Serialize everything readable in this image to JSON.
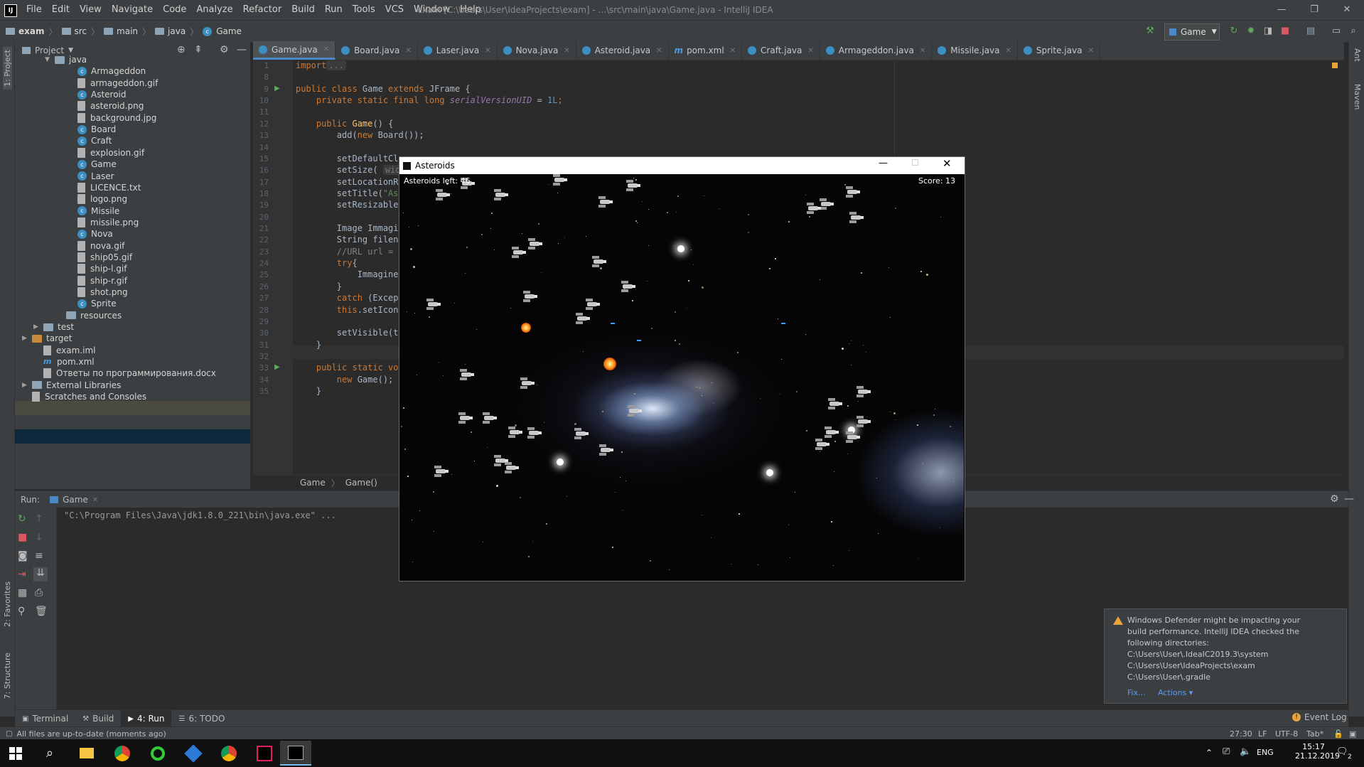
{
  "window": {
    "title": "exam [C:\\Users\\User\\IdeaProjects\\exam] - ...\\src\\main\\java\\Game.java - IntelliJ IDEA",
    "logo": "IJ"
  },
  "menu": [
    "File",
    "Edit",
    "View",
    "Navigate",
    "Code",
    "Analyze",
    "Refactor",
    "Build",
    "Run",
    "Tools",
    "VCS",
    "Window",
    "Help"
  ],
  "breadcrumbs": [
    "exam",
    "src",
    "main",
    "java",
    "Game"
  ],
  "run_config": "Game",
  "project_panel": {
    "title": "Project",
    "tree": [
      {
        "label": "java",
        "kind": "folder",
        "depth": 2,
        "arrow": "▼"
      },
      {
        "label": "Armageddon",
        "kind": "class",
        "depth": 4
      },
      {
        "label": "armageddon.gif",
        "kind": "file",
        "depth": 4
      },
      {
        "label": "Asteroid",
        "kind": "class",
        "depth": 4
      },
      {
        "label": "asteroid.png",
        "kind": "file",
        "depth": 4
      },
      {
        "label": "background.jpg",
        "kind": "file",
        "depth": 4
      },
      {
        "label": "Board",
        "kind": "class",
        "depth": 4
      },
      {
        "label": "Craft",
        "kind": "class",
        "depth": 4
      },
      {
        "label": "explosion.gif",
        "kind": "file",
        "depth": 4
      },
      {
        "label": "Game",
        "kind": "class",
        "depth": 4
      },
      {
        "label": "Laser",
        "kind": "class",
        "depth": 4
      },
      {
        "label": "LICENCE.txt",
        "kind": "file",
        "depth": 4
      },
      {
        "label": "logo.png",
        "kind": "file",
        "depth": 4
      },
      {
        "label": "Missile",
        "kind": "class",
        "depth": 4
      },
      {
        "label": "missile.png",
        "kind": "file",
        "depth": 4
      },
      {
        "label": "Nova",
        "kind": "class",
        "depth": 4
      },
      {
        "label": "nova.gif",
        "kind": "file",
        "depth": 4
      },
      {
        "label": "ship05.gif",
        "kind": "file",
        "depth": 4
      },
      {
        "label": "ship-l.gif",
        "kind": "file",
        "depth": 4
      },
      {
        "label": "ship-r.gif",
        "kind": "file",
        "depth": 4
      },
      {
        "label": "shot.png",
        "kind": "file",
        "depth": 4
      },
      {
        "label": "Sprite",
        "kind": "class",
        "depth": 4
      },
      {
        "label": "resources",
        "kind": "folder",
        "depth": 3
      },
      {
        "label": "test",
        "kind": "folder",
        "depth": 1,
        "arrow": "▶"
      },
      {
        "label": "target",
        "kind": "folder-orange",
        "depth": 0,
        "arrow": "▶"
      },
      {
        "label": "exam.iml",
        "kind": "file",
        "depth": 1
      },
      {
        "label": "pom.xml",
        "kind": "maven",
        "depth": 1,
        "selected": true
      },
      {
        "label": "Ответы по программирования.docx",
        "kind": "file",
        "depth": 1
      },
      {
        "label": "External Libraries",
        "kind": "lib",
        "depth": 0,
        "arrow": "▶"
      },
      {
        "label": "Scratches and Consoles",
        "kind": "scratch",
        "depth": 0
      }
    ]
  },
  "tabs": [
    {
      "label": "Game.java",
      "kind": "class",
      "active": true
    },
    {
      "label": "Board.java",
      "kind": "class"
    },
    {
      "label": "Laser.java",
      "kind": "class"
    },
    {
      "label": "Nova.java",
      "kind": "class"
    },
    {
      "label": "Asteroid.java",
      "kind": "class"
    },
    {
      "label": "pom.xml",
      "kind": "maven"
    },
    {
      "label": "Craft.java",
      "kind": "class"
    },
    {
      "label": "Armageddon.java",
      "kind": "class"
    },
    {
      "label": "Missile.java",
      "kind": "class"
    },
    {
      "label": "Sprite.java",
      "kind": "class"
    }
  ],
  "code": {
    "line_numbers": [
      "1",
      "8",
      "9",
      "10",
      "11",
      "12",
      "13",
      "14",
      "15",
      "16",
      "17",
      "18",
      "19",
      "20",
      "21",
      "22",
      "23",
      "24",
      "25",
      "26",
      "27",
      "28",
      "29",
      "30",
      "31",
      "32",
      "33",
      "34",
      "35"
    ],
    "import_kw": "import",
    "import_fold": "...",
    "l9_a": "public class ",
    "l9_b": "Game ",
    "l9_c": "extends ",
    "l9_d": "JFrame {",
    "l10_a": "    private static final long ",
    "l10_b": "serialVersionUID",
    "l10_c": " = ",
    "l10_d": "1L",
    "l10_e": ";",
    "l12_a": "    public ",
    "l12_b": "Game",
    "l12_c": "() {",
    "l13_a": "        add(",
    "l13_b": "new ",
    "l13_c": "Board());",
    "l15": "        setDefaultClo",
    "l16_a": "        setSize( ",
    "l16_b": "width",
    "l17": "        setLocationRe",
    "l18_a": "        setTitle(",
    "l18_b": "\"Ast",
    "l19": "        setResizable(",
    "l21": "        Image Immagin",
    "l22": "        String filena",
    "l23": "        //URL url = t",
    "l24_a": "        ",
    "l24_b": "try",
    "l24_c": "{",
    "l25": "            Immagine",
    "l26": "        }",
    "l27_a": "        ",
    "l27_b": "catch",
    "l27_c": " (Except",
    "l28_a": "        ",
    "l28_b": "this",
    "l28_c": ".setIconI",
    "l30": "        setVisible(tr",
    "l31": "    }",
    "l33_a": "    public static voi",
    "l34_a": "        ",
    "l34_b": "new ",
    "l34_c": "Game();",
    "l35": "    }"
  },
  "editor_breadcrumb": [
    "Game",
    "Game()"
  ],
  "run_panel": {
    "label": "Run:",
    "tab": "Game",
    "output": "\"C:\\Program Files\\Java\\jdk1.8.0_221\\bin\\java.exe\" ..."
  },
  "bottom_tabs": [
    {
      "label": "Terminal",
      "icon": "terminal-icon"
    },
    {
      "label": "Build",
      "icon": "hammer-icon"
    },
    {
      "label": "4: Run",
      "icon": "run-icon",
      "active": true
    },
    {
      "label": "6: TODO",
      "icon": "list-icon"
    }
  ],
  "event_log": "Event Log",
  "status": {
    "message": "All files are up-to-date (moments ago)",
    "position": "27:30",
    "line_sep": "LF",
    "encoding": "UTF-8",
    "indent": "Tab*"
  },
  "side_tabs": {
    "left": [
      "1: Project",
      "2: Favorites",
      "7: Structure"
    ],
    "right": [
      "Ant",
      "Maven"
    ]
  },
  "game": {
    "title": "Asteroids",
    "asteroids_left": "Asteroids left: 46",
    "score": "Score: 13"
  },
  "notification": {
    "lines": [
      "Windows Defender might be impacting your",
      "build performance. IntelliJ IDEA checked the",
      "following directories:",
      "C:\\Users\\User\\.IdeaIC2019.3\\system",
      "C:\\Users\\User\\IdeaProjects\\exam",
      "C:\\Users\\User\\.gradle"
    ],
    "fix": "Fix...",
    "actions": "Actions ▾"
  },
  "taskbar": {
    "time": "15:17",
    "date": "21.12.2019",
    "lang": "ENG",
    "notif_count": "2"
  },
  "colors": {
    "accent": "#4a88c7",
    "ide_bg": "#2b2b2b",
    "panel_bg": "#3c3f41",
    "keyword": "#cc7832",
    "field": "#9876aa",
    "number": "#6897bb"
  }
}
